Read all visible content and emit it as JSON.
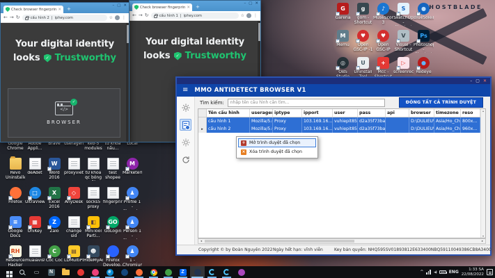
{
  "ui": {
    "glyphs": {
      "minimize": "–",
      "maximize": "▢",
      "close": "✕",
      "new_tab": "+",
      "back": "←",
      "forward": "→",
      "reload": "↻",
      "star": "☆",
      "kebab": "⋮",
      "hamburger": "≡",
      "check": "✓",
      "code": "</>",
      "pipe": "|",
      "left": "◂",
      "right": "▸",
      "up": "▴",
      "down": "▾",
      "chevron": "^",
      "speaker": "◄)"
    }
  },
  "wallpaper": {
    "brand": "GHOSTBLADE"
  },
  "browser_windows": [
    {
      "tab_title": "Check browser fingerprints",
      "profile": "cấu hình 2",
      "site": "iphey.com",
      "headline": "Your digital identity",
      "headline2": "looks",
      "verdict": "Trustworthy",
      "card_label": "BROWSER"
    },
    {
      "tab_title": "Check browser fingerprints",
      "profile": "cấu hình 1",
      "site": "iphey.com",
      "headline": "Your digital identity",
      "headline2": "looks",
      "verdict": "Trustworthy"
    }
  ],
  "app": {
    "title": "MMO ANTIDETECT BROWSER V1",
    "search_label": "Tìm kiếm:",
    "search_placeholder": "nhập tên cấu hình cần tìm...",
    "close_all_button": "ĐÓNG TẤT CẢ TRÌNH DUYỆT",
    "table": {
      "columns": [
        {
          "label": "Tên cấu hình",
          "cls": "c1"
        },
        {
          "label": "useragent",
          "cls": "c2"
        },
        {
          "label": "iptype",
          "cls": "c3"
        },
        {
          "label": "ipport",
          "cls": "c4"
        },
        {
          "label": "user",
          "cls": "c5"
        },
        {
          "label": "pass",
          "cls": "c6"
        },
        {
          "label": "api",
          "cls": "c7"
        },
        {
          "label": "browser",
          "cls": "c8"
        },
        {
          "label": "timezone",
          "cls": "c9"
        },
        {
          "label": "reso",
          "cls": "c10"
        }
      ],
      "rows": [
        {
          "state": "sel",
          "marker": "",
          "name": "cấu hình 1",
          "useragent": "Mozilla/5.0 (...",
          "iptype": "Proxy",
          "ipport": "103.169.16...",
          "user": "vuhiepit85",
          "pass": "d2a35f73ba...",
          "api": "",
          "browser": "D:\\DULIEU\\...",
          "timezone": "Asia/Ho_Chi...",
          "reso": "800x..."
        },
        {
          "state": "sel",
          "marker": "▸",
          "name": "cấu hình 2",
          "useragent": "Mozilla/5.0 (...",
          "iptype": "Proxy",
          "ipport": "103.169.16...",
          "user": "vuhiepit85",
          "pass": "d2a35f73ba...",
          "api": "",
          "browser": "D:\\DULIEU\\...",
          "timezone": "Asia/Ho_Chi...",
          "reso": "960x..."
        }
      ]
    },
    "context_menu": {
      "items": [
        {
          "label": "Mở trình duyệt đã chọn",
          "sel": "selected",
          "ibg": "#b23b2e",
          "ig": "+"
        },
        {
          "label": "Xóa trình duyệt đã chọn",
          "sel": "",
          "ibg": "#e67e22",
          "ig": "×"
        }
      ]
    },
    "footer": {
      "copyright": "Copyright © by Đoàn Nguyên 2022",
      "expiry": "Ngày hết hạn:  vĩnh viễn",
      "license": "Key bản quyền: NHQ595SV01893812E633400NBQ59110049386CB8A3400"
    }
  },
  "desktop": {
    "left_icons": [
      {
        "label": "Google Chrome",
        "kind": "chrome",
        "sc": "sc"
      },
      {
        "label": "Adobe Appli...",
        "kind": "folder",
        "sc": "sc"
      },
      {
        "label": "Brave",
        "kind": "circle",
        "bg": "#ff5500",
        "sc": "sc"
      },
      {
        "label": "useragent",
        "kind": "doc"
      },
      {
        "label": "keb-5 modules",
        "kind": "doc"
      },
      {
        "label": "từ khóa nấu...",
        "kind": "doc"
      },
      {
        "label": "Local",
        "kind": "folder"
      },
      {
        "label": "Revo Uninstaller",
        "kind": "folder"
      },
      {
        "label": "deAdet",
        "kind": "doc"
      },
      {
        "label": "Word 2016",
        "kind": "square",
        "bg": "#2b579a",
        "glyph": "W",
        "sc": "sc"
      },
      {
        "label": "proxyvietpn",
        "kind": "doc"
      },
      {
        "label": "từ khóa qc bóng đá",
        "kind": "doc"
      },
      {
        "label": "test shopee",
        "kind": "doc"
      },
      {
        "label": "Marketer8...",
        "kind": "circle",
        "bg": "#8e24aa",
        "glyph": "M",
        "sc": "sc"
      },
      {
        "label": "Firefox",
        "kind": "circle",
        "bg": "#ff7139",
        "sc": "sc"
      },
      {
        "label": "UltraViewer",
        "kind": "circle",
        "bg": "#1e88e5",
        "glyph": "□",
        "sc": "sc"
      },
      {
        "label": "Excel 2016",
        "kind": "square",
        "bg": "#217346",
        "glyph": "X",
        "sc": "sc"
      },
      {
        "label": "AnyDesk",
        "kind": "square",
        "bg": "#ef443b",
        "glyph": "◇",
        "sc": "sc"
      },
      {
        "label": "socks5 proxy",
        "kind": "doc"
      },
      {
        "label": "fingerprint",
        "kind": "doc"
      },
      {
        "label": "Profile 1 - Chromium",
        "kind": "circle",
        "bg": "#4285f4",
        "glyph": "♟",
        "sc": "sc"
      },
      {
        "label": "Google Docs",
        "kind": "square",
        "bg": "#4a8cf7",
        "glyph": "≡",
        "sc": "sc"
      },
      {
        "label": "UniKey",
        "kind": "square",
        "bg": "#e53935",
        "glyph": "▦",
        "sc": "sc"
      },
      {
        "label": "Zalo",
        "kind": "circle",
        "bg": "#0068ff",
        "glyph": "Z",
        "sc": "sc"
      },
      {
        "label": "change sid",
        "kind": "doc"
      },
      {
        "label": "MiniTool Parti...",
        "kind": "square",
        "bg": "#ffc107",
        "fg": "#5d4037",
        "glyph": "◧",
        "sc": "sc"
      },
      {
        "label": "GoLogin",
        "kind": "circle",
        "bg": "#00a868",
        "glyph": "GO",
        "sc": "sc"
      },
      {
        "label": "Person 1 - Chromium",
        "kind": "circle",
        "bg": "#4285f4",
        "glyph": "♟",
        "sc": "sc"
      },
      {
        "label": "Resource Hacker",
        "kind": "square",
        "bg": "#fff8e1",
        "fg": "#d84315",
        "glyph": "RH",
        "sc": "sc"
      },
      {
        "label": "muaiavist-...",
        "kind": "doc"
      },
      {
        "label": "Cốc Cốc",
        "kind": "circle",
        "bg": "#43a047",
        "glyph": "C",
        "sc": "sc"
      },
      {
        "label": "LDMultiPla...",
        "kind": "square",
        "bg": "#ffca28",
        "fg": "#4e342e",
        "glyph": "▤",
        "sc": "sc"
      },
      {
        "label": "HideMyAcc",
        "kind": "square",
        "bg": "#34495e",
        "glyph": "☻",
        "sc": "sc"
      },
      {
        "label": "Firefox Develop...",
        "kind": "circle",
        "bg": "#2962ff",
        "sc": "sc"
      },
      {
        "label": "1 - Chromium",
        "kind": "circle",
        "bg": "#4285f4",
        "glyph": "♟",
        "sc": "sc"
      }
    ],
    "right_icons": [
      {
        "label": "Garena",
        "kind": "square",
        "bg": "#b71c1c",
        "glyph": "G",
        "sc": "sc"
      },
      {
        "label": "gom - Shortcut",
        "kind": "square",
        "bg": "#37474f",
        "glyph": "g",
        "sc": "sc"
      },
      {
        "label": "MuseScore 3",
        "kind": "circle",
        "bg": "#1976d2",
        "glyph": "♪",
        "sc": "sc"
      },
      {
        "label": "SketchUp - Shortcut",
        "kind": "square",
        "bg": "#e3f2fd",
        "fg": "#1565c0",
        "glyph": "S",
        "sc": "sc"
      },
      {
        "label": "BlueSoleil",
        "kind": "circle",
        "bg": "#1565c0",
        "fg": "#bbdefb",
        "glyph": "●",
        "sc": "sc"
      },
      {
        "label": "Memu",
        "kind": "square",
        "bg": "#607d8b",
        "glyph": "M",
        "sc": "sc"
      },
      {
        "label": "Open GSC-IP -1",
        "kind": "circle",
        "bg": "#d32f2f",
        "glyph": "♥",
        "sc": "sc"
      },
      {
        "label": "Open GSC-IP",
        "kind": "circle",
        "bg": "#d32f2f",
        "glyph": "♥",
        "sc": "sc"
      },
      {
        "label": "Visual - Shortcut",
        "kind": "square",
        "bg": "#b0bec5",
        "fg": "#37474f",
        "glyph": "V",
        "sc": "sc"
      },
      {
        "label": "Photoshop - Shortcut",
        "kind": "square",
        "bg": "#001e36",
        "fg": "#31a8ff",
        "glyph": "Ps",
        "sc": "sc"
      },
      {
        "label": "OBS Studio",
        "kind": "circle",
        "bg": "#263238",
        "fg": "#eceff1",
        "glyph": "◎",
        "sc": "sc"
      },
      {
        "label": "Uninstall Tool",
        "kind": "square",
        "bg": "#eceff1",
        "fg": "#455a64",
        "glyph": "U",
        "sc": "sc"
      },
      {
        "label": "Mcc - Shortcut",
        "kind": "square",
        "bg": "#e53935",
        "glyph": "+",
        "sc": "sc"
      },
      {
        "label": "screenrec - Shortcut",
        "kind": "square",
        "bg": "#fce4ec",
        "fg": "#e53935",
        "glyph": "▷",
        "sc": "sc"
      },
      {
        "label": "Redeye",
        "kind": "circle",
        "bg": "#b71c1c",
        "fg": "#64b5f6",
        "glyph": "●",
        "sc": "sc"
      }
    ]
  },
  "taskbar": {
    "buttons": [
      {
        "kind": "win"
      },
      {
        "kind": "search"
      },
      {
        "kind": "glyph",
        "fg": "#cfd8dc",
        "glyph": "▭"
      },
      {
        "kind": "square",
        "bg": "#455a64",
        "glyph": "N"
      },
      {
        "kind": "folder"
      },
      {
        "kind": "circle",
        "bg": "#e53935"
      },
      {
        "kind": "circle",
        "bg": "#ec407a",
        "state": "running"
      },
      {
        "kind": "circle",
        "bg": "#0b8bd0",
        "glyph": "e",
        "state": "running"
      },
      {
        "kind": "circle",
        "bg": "#16477c"
      },
      {
        "kind": "circle",
        "bg": "#ff7139",
        "state": "running"
      },
      {
        "kind": "chrome",
        "state": "running"
      },
      {
        "kind": "circle",
        "bg": "#43a047",
        "state": "running"
      },
      {
        "kind": "square",
        "bg": "#0068ff",
        "glyph": "Z",
        "state": "running"
      },
      {
        "kind": "circle",
        "bg": "#22324d",
        "state": "active"
      },
      {
        "kind": "arc",
        "state": "running"
      },
      {
        "kind": "arc",
        "state": "running"
      },
      {
        "kind": "circle",
        "bg": "#ab47bc"
      }
    ],
    "lang": "ENG",
    "time": "1:33 SA",
    "date": "22/08/2022"
  }
}
